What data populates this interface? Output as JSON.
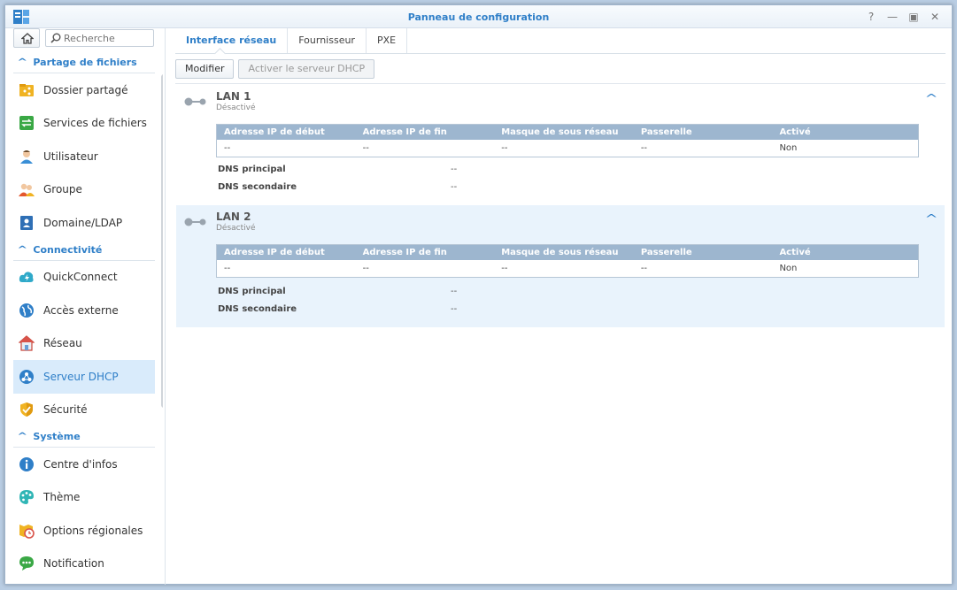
{
  "window": {
    "title": "Panneau de configuration"
  },
  "sidebar": {
    "search_placeholder": "Recherche",
    "sections": [
      {
        "header": "Partage de fichiers",
        "items": [
          {
            "label": "Dossier partagé",
            "icon": "shared-folder-icon"
          },
          {
            "label": "Services de fichiers",
            "icon": "file-services-icon"
          },
          {
            "label": "Utilisateur",
            "icon": "user-icon"
          },
          {
            "label": "Groupe",
            "icon": "group-icon"
          },
          {
            "label": "Domaine/LDAP",
            "icon": "domain-ldap-icon"
          }
        ]
      },
      {
        "header": "Connectivité",
        "items": [
          {
            "label": "QuickConnect",
            "icon": "quickconnect-icon"
          },
          {
            "label": "Accès externe",
            "icon": "external-access-icon"
          },
          {
            "label": "Réseau",
            "icon": "network-icon"
          },
          {
            "label": "Serveur DHCP",
            "icon": "dhcp-server-icon",
            "selected": true
          },
          {
            "label": "Sécurité",
            "icon": "security-icon"
          }
        ]
      },
      {
        "header": "Système",
        "items": [
          {
            "label": "Centre d'infos",
            "icon": "info-center-icon"
          },
          {
            "label": "Thème",
            "icon": "theme-icon"
          },
          {
            "label": "Options régionales",
            "icon": "regional-options-icon"
          },
          {
            "label": "Notification",
            "icon": "notification-icon"
          }
        ]
      }
    ]
  },
  "tabs": [
    "Interface réseau",
    "Fournisseur",
    "PXE"
  ],
  "toolbar": {
    "edit_label": "Modifier",
    "enable_dhcp_label": "Activer le serveur DHCP"
  },
  "lans": [
    {
      "name": "LAN 1",
      "status": "Désactivé",
      "columns": [
        "Adresse IP de début",
        "Adresse IP de fin",
        "Masque de sous réseau",
        "Passerelle",
        "Activé"
      ],
      "row": [
        "--",
        "--",
        "--",
        "--",
        "Non"
      ],
      "dns_primary_label": "DNS principal",
      "dns_primary_value": "--",
      "dns_secondary_label": "DNS secondaire",
      "dns_secondary_value": "--"
    },
    {
      "name": "LAN 2",
      "status": "Désactivé",
      "columns": [
        "Adresse IP de début",
        "Adresse IP de fin",
        "Masque de sous réseau",
        "Passerelle",
        "Activé"
      ],
      "row": [
        "--",
        "--",
        "--",
        "--",
        "Non"
      ],
      "dns_primary_label": "DNS principal",
      "dns_primary_value": "--",
      "dns_secondary_label": "DNS secondaire",
      "dns_secondary_value": "--"
    }
  ]
}
